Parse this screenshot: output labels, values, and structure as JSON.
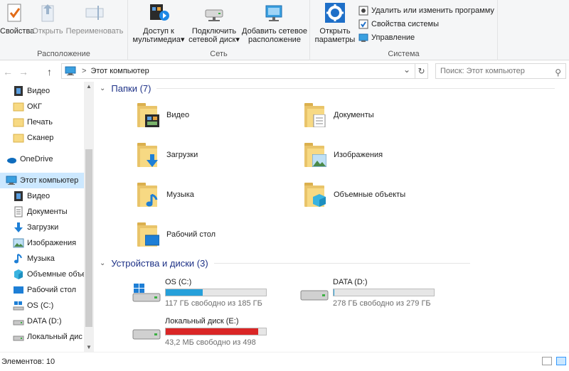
{
  "ribbon": {
    "groups": [
      {
        "label": "Расположение"
      },
      {
        "label": "Сеть"
      },
      {
        "label": "Система"
      }
    ],
    "location_buttons": {
      "properties": "Свойства",
      "open": "Открыть",
      "rename": "Переименовать"
    },
    "network_buttons": {
      "media_line1": "Доступ к",
      "media_line2": "мультимедиа",
      "map_line1": "Подключить",
      "map_line2": "сетевой диск",
      "add_line1": "Добавить сетевое",
      "add_line2": "расположение"
    },
    "system_buttons": {
      "settings_line1": "Открыть",
      "settings_line2": "параметры",
      "uninstall": "Удалить или изменить программу",
      "system_props": "Свойства системы",
      "manage": "Управление"
    },
    "dropdown_glyph": "▾"
  },
  "nav": {
    "back": "←",
    "forward": "→",
    "up": "↑",
    "address_sep": ">",
    "address": "Этот компьютер",
    "dropdown": "⌄",
    "refresh": "↻",
    "search_placeholder": "Поиск: Этот компьютер",
    "search_icon": "⚲"
  },
  "sidebar": {
    "items": [
      {
        "label": "Видео",
        "icon": "video-icon"
      },
      {
        "label": "ОКГ",
        "icon": "folder-icon"
      },
      {
        "label": "Печать",
        "icon": "folder-icon"
      },
      {
        "label": "Сканер",
        "icon": "folder-icon"
      },
      {
        "label": "OneDrive",
        "icon": "cloud-icon"
      },
      {
        "label": "Этот компьютер",
        "icon": "computer-icon"
      },
      {
        "label": "Видео",
        "icon": "video-icon"
      },
      {
        "label": "Документы",
        "icon": "documents-icon"
      },
      {
        "label": "Загрузки",
        "icon": "download-icon"
      },
      {
        "label": "Изображения",
        "icon": "images-icon"
      },
      {
        "label": "Музыка",
        "icon": "music-icon"
      },
      {
        "label": "Объемные объе",
        "icon": "cube-icon"
      },
      {
        "label": "Рабочий стол",
        "icon": "desktop-icon"
      },
      {
        "label": "OS (C:)",
        "icon": "windows-drive-icon"
      },
      {
        "label": "DATA (D:)",
        "icon": "drive-icon"
      },
      {
        "label": "Локальный дис",
        "icon": "drive-icon"
      }
    ],
    "scroll_up": "▲",
    "scroll_down": "▼"
  },
  "folders_section": {
    "title": "Папки (7)",
    "chevron": "⌄",
    "items": [
      {
        "label": "Видео"
      },
      {
        "label": "Документы"
      },
      {
        "label": "Загрузки"
      },
      {
        "label": "Изображения"
      },
      {
        "label": "Музыка"
      },
      {
        "label": "Объемные объекты"
      },
      {
        "label": "Рабочий стол"
      }
    ]
  },
  "drives_section": {
    "title": "Устройства и диски (3)",
    "chevron": "⌄",
    "items": [
      {
        "name": "OS (C:)",
        "free": "117 ГБ свободно из 185 ГБ",
        "used_fraction": 0.37,
        "bar_color": "#26a0da"
      },
      {
        "name": "DATA (D:)",
        "free": "278 ГБ свободно из 279 ГБ",
        "used_fraction": 0.004,
        "bar_color": "#26a0da"
      },
      {
        "name": "Локальный диск (E:)",
        "free": "43,2 МБ свободно из 498",
        "used_fraction": 0.92,
        "bar_color": "#da2626"
      }
    ]
  },
  "status": {
    "count": "Элементов: 10"
  },
  "colors": {
    "accent": "#26a0da",
    "critical": "#da2626",
    "section_title": "#1e3287",
    "selection": "#cce8ff"
  }
}
